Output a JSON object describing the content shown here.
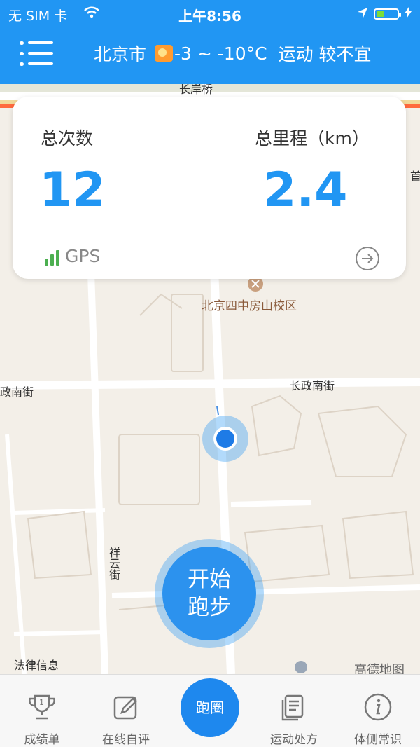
{
  "status_bar": {
    "carrier": "无 SIM 卡",
    "time": "上午8:56"
  },
  "header": {
    "city": "北京市",
    "temperature": "-3 ~ -10°C",
    "sport_advice": "运动 较不宜"
  },
  "stats_card": {
    "total_runs_label": "总次数",
    "total_runs_value": "12",
    "total_distance_label": "总里程（km）",
    "total_distance_value": "2.4",
    "gps_label": "GPS"
  },
  "map": {
    "labels": {
      "top_street": "长岸桥",
      "school": "北京四中房山校区",
      "street_left": "政南街",
      "street_right": "长政南街",
      "street_vertical": "祥云街",
      "bottom_left": "法律信息",
      "watermark": "高德地图",
      "edge_char": "首"
    }
  },
  "start_button": {
    "line1": "开始",
    "line2": "跑步"
  },
  "tabbar": {
    "items": [
      {
        "label": "成绩单",
        "icon": "trophy-icon"
      },
      {
        "label": "在线自评",
        "icon": "edit-icon"
      },
      {
        "label": "跑圈",
        "icon": "run-circle"
      },
      {
        "label": "运动处方",
        "icon": "document-icon"
      },
      {
        "label": "体侧常识",
        "icon": "info-icon"
      }
    ]
  },
  "colors": {
    "primary": "#2196f3",
    "gps_green": "#4caf50",
    "map_bg": "#f3efe8"
  }
}
